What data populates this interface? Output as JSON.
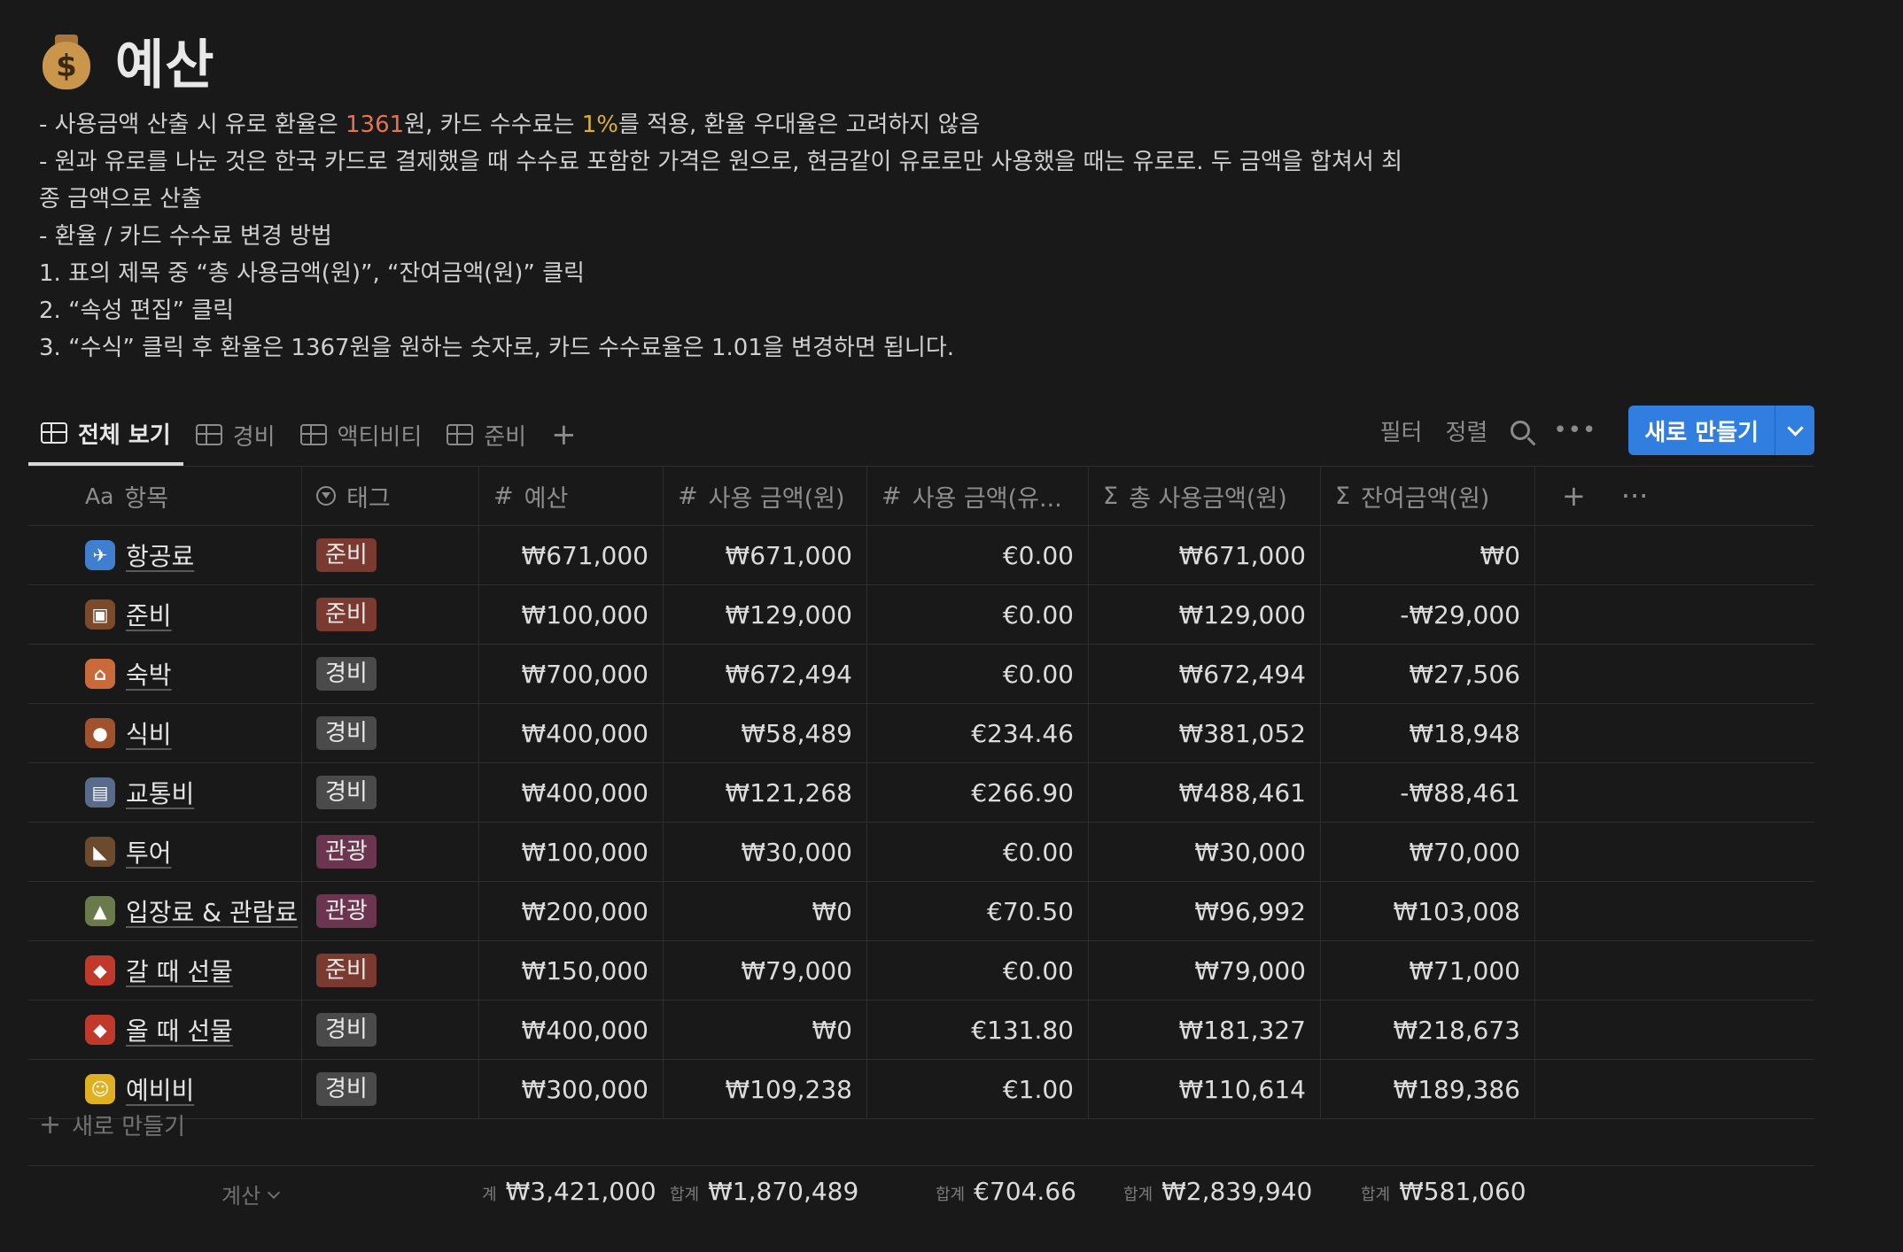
{
  "page": {
    "title": "예산",
    "icon": "money-bag-icon",
    "description": {
      "line1_pre": "- 사용금액 산출 시 유로 환율은 ",
      "line1_rate": "1361",
      "line1_mid": "원, 카드 수수료는 ",
      "line1_fee": "1%",
      "line1_post": "를 적용, 환율 우대율은 고려하지 않음",
      "line2": "- 원과 유로를 나눈 것은 한국 카드로 결제했을 때 수수료 포함한 가격은 원으로, 현금같이 유로로만 사용했을 때는 유로로. 두 금액을 합쳐서 최",
      "line3": "종 금액으로 산출",
      "line4": "- 환율 / 카드 수수료 변경 방법",
      "line5": "1. 표의 제목 중 “총 사용금액(원)”, “잔여금액(원)” 클릭",
      "line6": "2. “속성 편집” 클릭",
      "line7": "3. “수식” 클릭 후 환율은 1367원을 원하는 숫자로, 카드 수수료율은 1.01을 변경하면 됩니다."
    },
    "colors": {
      "accent": "#2f7ee0",
      "rate": "#e8734f",
      "fee": "#d8b03c"
    }
  },
  "views": [
    {
      "label": "전체 보기",
      "active": true
    },
    {
      "label": "경비",
      "active": false
    },
    {
      "label": "액티비티",
      "active": false
    },
    {
      "label": "준비",
      "active": false
    }
  ],
  "toolbar": {
    "filter": "필터",
    "sort": "정렬",
    "new": "새로 만들기"
  },
  "table": {
    "headers": {
      "name_prefix": "Aa",
      "name": "항목",
      "tag": "태그",
      "budget": "예산",
      "used_krw": "사용 금액(원)",
      "used_eur": "사용 금액(유...",
      "total_krw": "총 사용금액(원)",
      "remain_krw": "잔여금액(원)"
    },
    "rows": [
      {
        "emoji": "airplane-icon",
        "name": "항공료",
        "tag": "준비",
        "budget": "₩671,000",
        "used_krw": "₩671,000",
        "used_eur": "€0.00",
        "total_krw": "₩671,000",
        "remain_krw": "₩0"
      },
      {
        "emoji": "luggage-icon",
        "name": "준비",
        "tag": "준비",
        "budget": "₩100,000",
        "used_krw": "₩129,000",
        "used_eur": "€0.00",
        "total_krw": "₩129,000",
        "remain_krw": "-₩29,000"
      },
      {
        "emoji": "house-icon",
        "name": "숙박",
        "tag": "경비",
        "budget": "₩700,000",
        "used_krw": "₩672,494",
        "used_eur": "€0.00",
        "total_krw": "₩672,494",
        "remain_krw": "₩27,506"
      },
      {
        "emoji": "drumstick-icon",
        "name": "식비",
        "tag": "경비",
        "budget": "₩400,000",
        "used_krw": "₩58,489",
        "used_eur": "€234.46",
        "total_krw": "₩381,052",
        "remain_krw": "₩18,948"
      },
      {
        "emoji": "train-icon",
        "name": "교통비",
        "tag": "경비",
        "budget": "₩400,000",
        "used_krw": "₩121,268",
        "used_eur": "€266.90",
        "total_krw": "₩488,461",
        "remain_krw": "-₩88,461"
      },
      {
        "emoji": "boot-icon",
        "name": "투어",
        "tag": "관광",
        "budget": "₩100,000",
        "used_krw": "₩30,000",
        "used_eur": "€0.00",
        "total_krw": "₩30,000",
        "remain_krw": "₩70,000"
      },
      {
        "emoji": "mountain-icon",
        "name": "입장료 & 관람료",
        "tag": "관광",
        "budget": "₩200,000",
        "used_krw": "₩0",
        "used_eur": "€70.50",
        "total_krw": "₩96,992",
        "remain_krw": "₩103,008"
      },
      {
        "emoji": "gift-icon",
        "name": "갈 때 선물",
        "tag": "준비",
        "budget": "₩150,000",
        "used_krw": "₩79,000",
        "used_eur": "€0.00",
        "total_krw": "₩79,000",
        "remain_krw": "₩71,000"
      },
      {
        "emoji": "gift-icon",
        "name": "올 때 선물",
        "tag": "경비",
        "budget": "₩400,000",
        "used_krw": "₩0",
        "used_eur": "€131.80",
        "total_krw": "₩181,327",
        "remain_krw": "₩218,673"
      },
      {
        "emoji": "money-face-icon",
        "name": "예비비",
        "tag": "경비",
        "budget": "₩300,000",
        "used_krw": "₩109,238",
        "used_eur": "€1.00",
        "total_krw": "₩110,614",
        "remain_krw": "₩189,386"
      }
    ],
    "new_row_label": "새로 만들기"
  },
  "calc": {
    "label": "계산",
    "budget_label": "계",
    "budget": "₩3,421,000",
    "used_krw_label": "합계",
    "used_krw": "₩1,870,489",
    "used_eur_label": "합계",
    "used_eur": "€704.66",
    "total_krw_label": "합계",
    "total_krw": "₩2,839,940",
    "remain_krw_label": "합계",
    "remain_krw": "₩581,060"
  }
}
